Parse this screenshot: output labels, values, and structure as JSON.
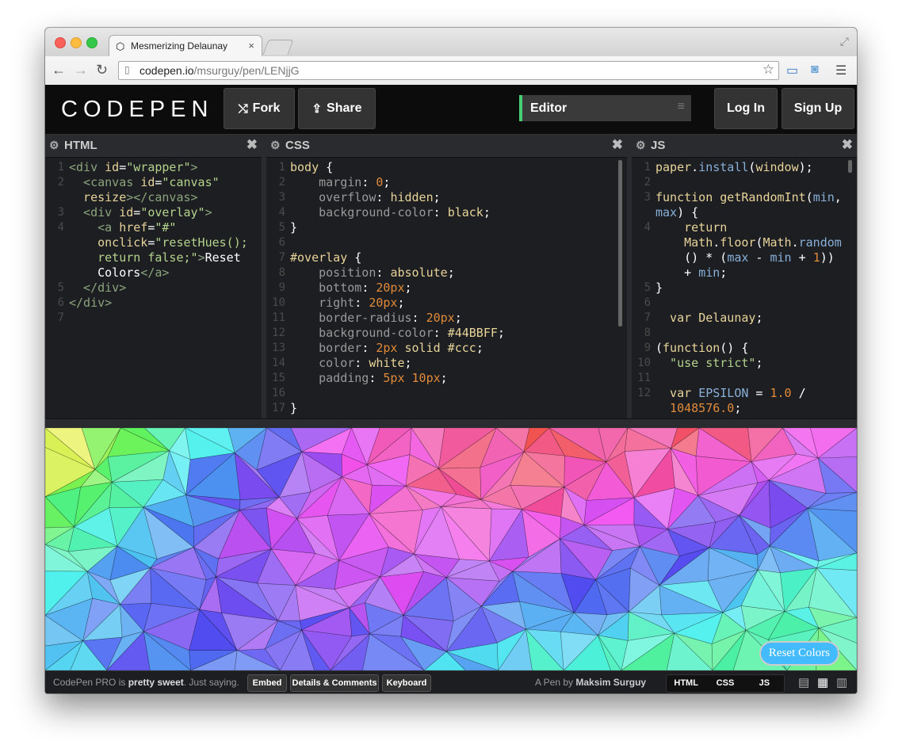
{
  "browser": {
    "tab_title": "Mesmerizing Delaunay",
    "tab_close": "×",
    "url_host": "codepen.io",
    "url_path": "/msurguy/pen/LENjjG"
  },
  "header": {
    "logo": "CODEPEN",
    "fork_label": "Fork",
    "share_label": "Share",
    "editor_label": "Editor",
    "login_label": "Log In",
    "signup_label": "Sign Up"
  },
  "panes": {
    "html": {
      "title": "HTML",
      "close": "✖"
    },
    "css": {
      "title": "CSS",
      "close": "✖"
    },
    "js": {
      "title": "JS",
      "close": "✖"
    }
  },
  "code": {
    "html": [
      {
        "n": "1",
        "segs": [
          [
            "tg",
            "<div "
          ],
          [
            "at",
            "id"
          ],
          [
            "pl",
            "="
          ],
          [
            "st",
            "\"wrapper\""
          ],
          [
            "tg",
            ">"
          ]
        ]
      },
      {
        "n": "2",
        "segs": [
          [
            "tg",
            "  <canvas "
          ],
          [
            "at",
            "id"
          ],
          [
            "pl",
            "="
          ],
          [
            "st",
            "\"canvas\""
          ]
        ]
      },
      {
        "n": "",
        "segs": [
          [
            "at",
            "  resize"
          ],
          [
            "tg",
            "></canvas>"
          ]
        ]
      },
      {
        "n": "3",
        "segs": [
          [
            "tg",
            "  <div "
          ],
          [
            "at",
            "id"
          ],
          [
            "pl",
            "="
          ],
          [
            "st",
            "\"overlay\""
          ],
          [
            "tg",
            ">"
          ]
        ]
      },
      {
        "n": "4",
        "segs": [
          [
            "tg",
            "    <a "
          ],
          [
            "at",
            "href"
          ],
          [
            "pl",
            "="
          ],
          [
            "st",
            "\"#\""
          ]
        ]
      },
      {
        "n": "",
        "segs": [
          [
            "at",
            "    onclick"
          ],
          [
            "pl",
            "="
          ],
          [
            "st",
            "\"resetHues();"
          ]
        ]
      },
      {
        "n": "",
        "segs": [
          [
            "st",
            "    return false;\""
          ],
          [
            "tg",
            ">"
          ],
          [
            "pl",
            "Reset"
          ]
        ]
      },
      {
        "n": "",
        "segs": [
          [
            "pl",
            "    Colors"
          ],
          [
            "tg",
            "</a>"
          ]
        ]
      },
      {
        "n": "5",
        "segs": [
          [
            "tg",
            "  </div>"
          ]
        ]
      },
      {
        "n": "6",
        "segs": [
          [
            "tg",
            "</div>"
          ]
        ]
      },
      {
        "n": "7",
        "segs": [
          [
            "pl",
            ""
          ]
        ]
      }
    ],
    "css": [
      {
        "n": "1",
        "segs": [
          [
            "sel",
            "body "
          ],
          [
            "pl",
            "{"
          ]
        ]
      },
      {
        "n": "2",
        "segs": [
          [
            "pr",
            "    margin"
          ],
          [
            "pl",
            ": "
          ],
          [
            "nm",
            "0"
          ],
          [
            "pl",
            ";"
          ]
        ]
      },
      {
        "n": "3",
        "segs": [
          [
            "pr",
            "    overflow"
          ],
          [
            "pl",
            ": "
          ],
          [
            "vl",
            "hidden"
          ],
          [
            "pl",
            ";"
          ]
        ]
      },
      {
        "n": "4",
        "segs": [
          [
            "pr",
            "    background-color"
          ],
          [
            "pl",
            ": "
          ],
          [
            "vl",
            "black"
          ],
          [
            "pl",
            ";"
          ]
        ]
      },
      {
        "n": "5",
        "segs": [
          [
            "pl",
            "}"
          ]
        ]
      },
      {
        "n": "6",
        "segs": [
          [
            "pl",
            ""
          ]
        ]
      },
      {
        "n": "7",
        "segs": [
          [
            "sel",
            "#overlay "
          ],
          [
            "pl",
            "{"
          ]
        ]
      },
      {
        "n": "8",
        "segs": [
          [
            "pr",
            "    position"
          ],
          [
            "pl",
            ": "
          ],
          [
            "vl",
            "absolute"
          ],
          [
            "pl",
            ";"
          ]
        ]
      },
      {
        "n": "9",
        "segs": [
          [
            "pr",
            "    bottom"
          ],
          [
            "pl",
            ": "
          ],
          [
            "nm",
            "20px"
          ],
          [
            "pl",
            ";"
          ]
        ]
      },
      {
        "n": "10",
        "segs": [
          [
            "pr",
            "    right"
          ],
          [
            "pl",
            ": "
          ],
          [
            "nm",
            "20px"
          ],
          [
            "pl",
            ";"
          ]
        ]
      },
      {
        "n": "11",
        "segs": [
          [
            "pr",
            "    border-radius"
          ],
          [
            "pl",
            ": "
          ],
          [
            "nm",
            "20px"
          ],
          [
            "pl",
            ";"
          ]
        ]
      },
      {
        "n": "12",
        "segs": [
          [
            "pr",
            "    background-color"
          ],
          [
            "pl",
            ": "
          ],
          [
            "vl",
            "#44BBFF"
          ],
          [
            "pl",
            ";"
          ]
        ]
      },
      {
        "n": "13",
        "segs": [
          [
            "pr",
            "    border"
          ],
          [
            "pl",
            ": "
          ],
          [
            "nm",
            "2px"
          ],
          [
            "vl",
            " solid #ccc"
          ],
          [
            "pl",
            ";"
          ]
        ]
      },
      {
        "n": "14",
        "segs": [
          [
            "pr",
            "    color"
          ],
          [
            "pl",
            ": "
          ],
          [
            "vl",
            "white"
          ],
          [
            "pl",
            ";"
          ]
        ]
      },
      {
        "n": "15",
        "segs": [
          [
            "pr",
            "    padding"
          ],
          [
            "pl",
            ": "
          ],
          [
            "nm",
            "5px 10px"
          ],
          [
            "pl",
            ";"
          ]
        ]
      },
      {
        "n": "16",
        "segs": [
          [
            "pl",
            ""
          ]
        ]
      },
      {
        "n": "17",
        "segs": [
          [
            "pl",
            "}"
          ]
        ]
      }
    ],
    "js": [
      {
        "n": "1",
        "segs": [
          [
            "fn",
            "paper"
          ],
          [
            "pl",
            "."
          ],
          [
            "id",
            "install"
          ],
          [
            "pl",
            "("
          ],
          [
            "fn",
            "window"
          ],
          [
            "pl",
            ");"
          ]
        ]
      },
      {
        "n": "2",
        "segs": [
          [
            "pl",
            ""
          ]
        ]
      },
      {
        "n": "3",
        "segs": [
          [
            "kw",
            "function "
          ],
          [
            "fn",
            "getRandomInt"
          ],
          [
            "pl",
            "("
          ],
          [
            "id",
            "min"
          ],
          [
            "pl",
            ","
          ]
        ]
      },
      {
        "n": "",
        "segs": [
          [
            "id",
            "max"
          ],
          [
            "pl",
            ") {"
          ]
        ]
      },
      {
        "n": "4",
        "segs": [
          [
            "kw",
            "    return"
          ]
        ]
      },
      {
        "n": "",
        "segs": [
          [
            "fn",
            "    Math"
          ],
          [
            "pl",
            "."
          ],
          [
            "fn",
            "floor"
          ],
          [
            "pl",
            "("
          ],
          [
            "fn",
            "Math"
          ],
          [
            "pl",
            "."
          ],
          [
            "id",
            "random"
          ]
        ]
      },
      {
        "n": "",
        "segs": [
          [
            "pl",
            "    () * ("
          ],
          [
            "id",
            "max"
          ],
          [
            "pl",
            " - "
          ],
          [
            "id",
            "min"
          ],
          [
            "pl",
            " + "
          ],
          [
            "nm",
            "1"
          ],
          [
            "pl",
            "))"
          ]
        ]
      },
      {
        "n": "",
        "segs": [
          [
            "pl",
            "    + "
          ],
          [
            "id",
            "min"
          ],
          [
            "pl",
            ";"
          ]
        ]
      },
      {
        "n": "5",
        "segs": [
          [
            "pl",
            "}"
          ]
        ]
      },
      {
        "n": "6",
        "segs": [
          [
            "pl",
            ""
          ]
        ]
      },
      {
        "n": "7",
        "segs": [
          [
            "kw",
            "  var "
          ],
          [
            "fn",
            "Delaunay"
          ],
          [
            "pl",
            ";"
          ]
        ]
      },
      {
        "n": "8",
        "segs": [
          [
            "pl",
            ""
          ]
        ]
      },
      {
        "n": "9",
        "segs": [
          [
            "pl",
            "("
          ],
          [
            "kw",
            "function"
          ],
          [
            "pl",
            "() {"
          ]
        ]
      },
      {
        "n": "10",
        "segs": [
          [
            "sr",
            "  \"use strict\""
          ],
          [
            "pl",
            ";"
          ]
        ]
      },
      {
        "n": "11",
        "segs": [
          [
            "pl",
            ""
          ]
        ]
      },
      {
        "n": "12",
        "segs": [
          [
            "kw",
            "  var "
          ],
          [
            "id",
            "EPSILON"
          ],
          [
            "pl",
            " = "
          ],
          [
            "nm",
            "1.0"
          ],
          [
            "pl",
            " /"
          ]
        ]
      },
      {
        "n": "",
        "segs": [
          [
            "nm",
            "  1048576.0"
          ],
          [
            "pl",
            ";"
          ]
        ]
      }
    ]
  },
  "canvas": {
    "reset_label": "Reset Colors"
  },
  "footer": {
    "promo_pre": "CodePen PRO is ",
    "promo_bold": "pretty sweet",
    "promo_post": ". Just saying.",
    "embed_label": "Embed",
    "details_label": "Details & Comments",
    "keyboard_label": "Keyboard",
    "byline_pre": "A Pen by ",
    "byline_author": "Maksim Surguy",
    "view_html": "HTML",
    "view_css": "CSS",
    "view_js": "JS"
  },
  "colors": {
    "accent": "#47cf73",
    "reset_bg": "#44bbff"
  }
}
